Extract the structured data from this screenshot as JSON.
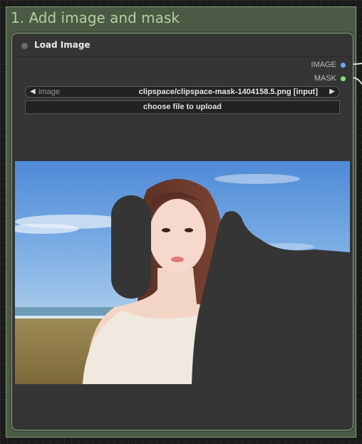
{
  "group": {
    "title": "1. Add image and mask"
  },
  "node": {
    "title": "Load Image",
    "outputs": [
      {
        "label": "IMAGE",
        "color": "#6fa8ff"
      },
      {
        "label": "MASK",
        "color": "#80e37a"
      }
    ],
    "combo": {
      "name": "image",
      "value": "clipspace/clipspace-mask-1404158.5.png [input]"
    },
    "upload_label": "choose file to upload"
  },
  "colors": {
    "group_bg": "#4b5a44",
    "group_title": "#b0d19e",
    "node_bg": "#353535",
    "mask": "#353535",
    "sky": "#5b93d8"
  }
}
